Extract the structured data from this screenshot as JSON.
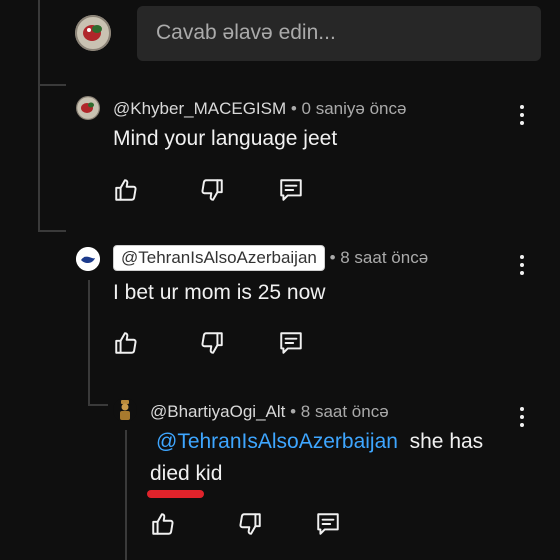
{
  "reply_input": {
    "placeholder": "Cavab əlavə edin..."
  },
  "comments": [
    {
      "handle": "@Khyber_MACEGISM",
      "time": " • 0 saniyə öncə",
      "text": "Mind your language jeet",
      "actions": [
        "like-icon",
        "dislike-icon",
        "reply-icon"
      ]
    },
    {
      "handle": "@TehranIsAlsoAzerbaijan",
      "time": " • 8 saat öncə",
      "text": "I bet ur mom is 25 now",
      "actions": [
        "like-icon",
        "dislike-icon",
        "reply-icon"
      ]
    },
    {
      "handle": "@BhartiyaOgi_Alt",
      "time": " • 8 saat öncə",
      "mention": "@TehranIsAlsoAzerbaijan",
      "text_line1": "she has",
      "text_line2": "died kid",
      "actions": [
        "like-icon",
        "dislike-icon",
        "reply-icon"
      ]
    }
  ],
  "colors": {
    "background": "#0f0f0f",
    "mention": "#3ea6ff",
    "annotation_underline": "#e0232b"
  }
}
